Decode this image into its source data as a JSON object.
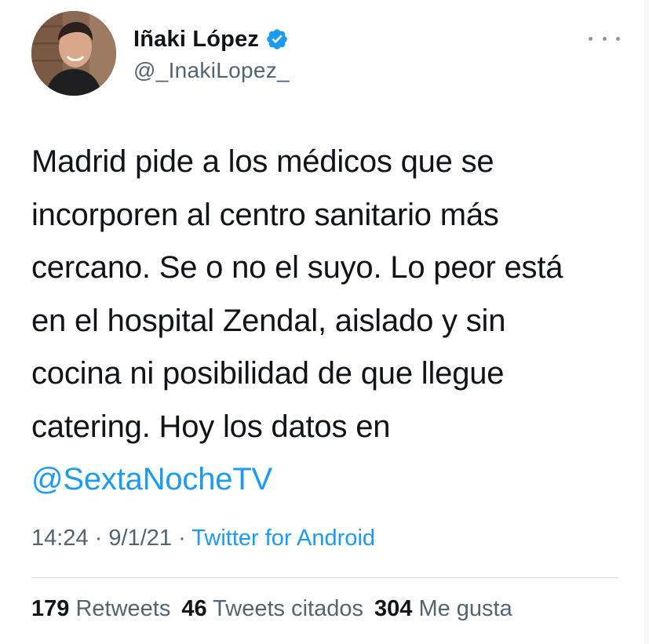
{
  "author": {
    "display_name": "Iñaki López",
    "handle": "@_InakiLopez_",
    "verified": true
  },
  "tweet": {
    "lines": [
      "Madrid pide a los médicos que se",
      "incorporen al centro sanitario más",
      "cercano. Se o no el suyo. Lo peor está",
      "en el hospital Zendal, aislado y sin",
      "cocina ni posibilidad de que llegue",
      "catering. Hoy los datos en"
    ],
    "mention": "@SextaNocheTV"
  },
  "meta": {
    "time": "14:24",
    "separator": "·",
    "date": "9/1/21",
    "source": "Twitter for Android"
  },
  "stats": {
    "retweets_count": "179",
    "retweets_label": "Retweets",
    "quotes_count": "46",
    "quotes_label": "Tweets citados",
    "likes_count": "304",
    "likes_label": "Me gusta"
  },
  "icons": {
    "verified": "verified-badge-icon",
    "more": "more-options-icon"
  },
  "colors": {
    "link": "#1d9bf0",
    "secondary_text": "#536471",
    "primary_text": "#0f1419",
    "verified_badge": "#1d9bf0"
  }
}
